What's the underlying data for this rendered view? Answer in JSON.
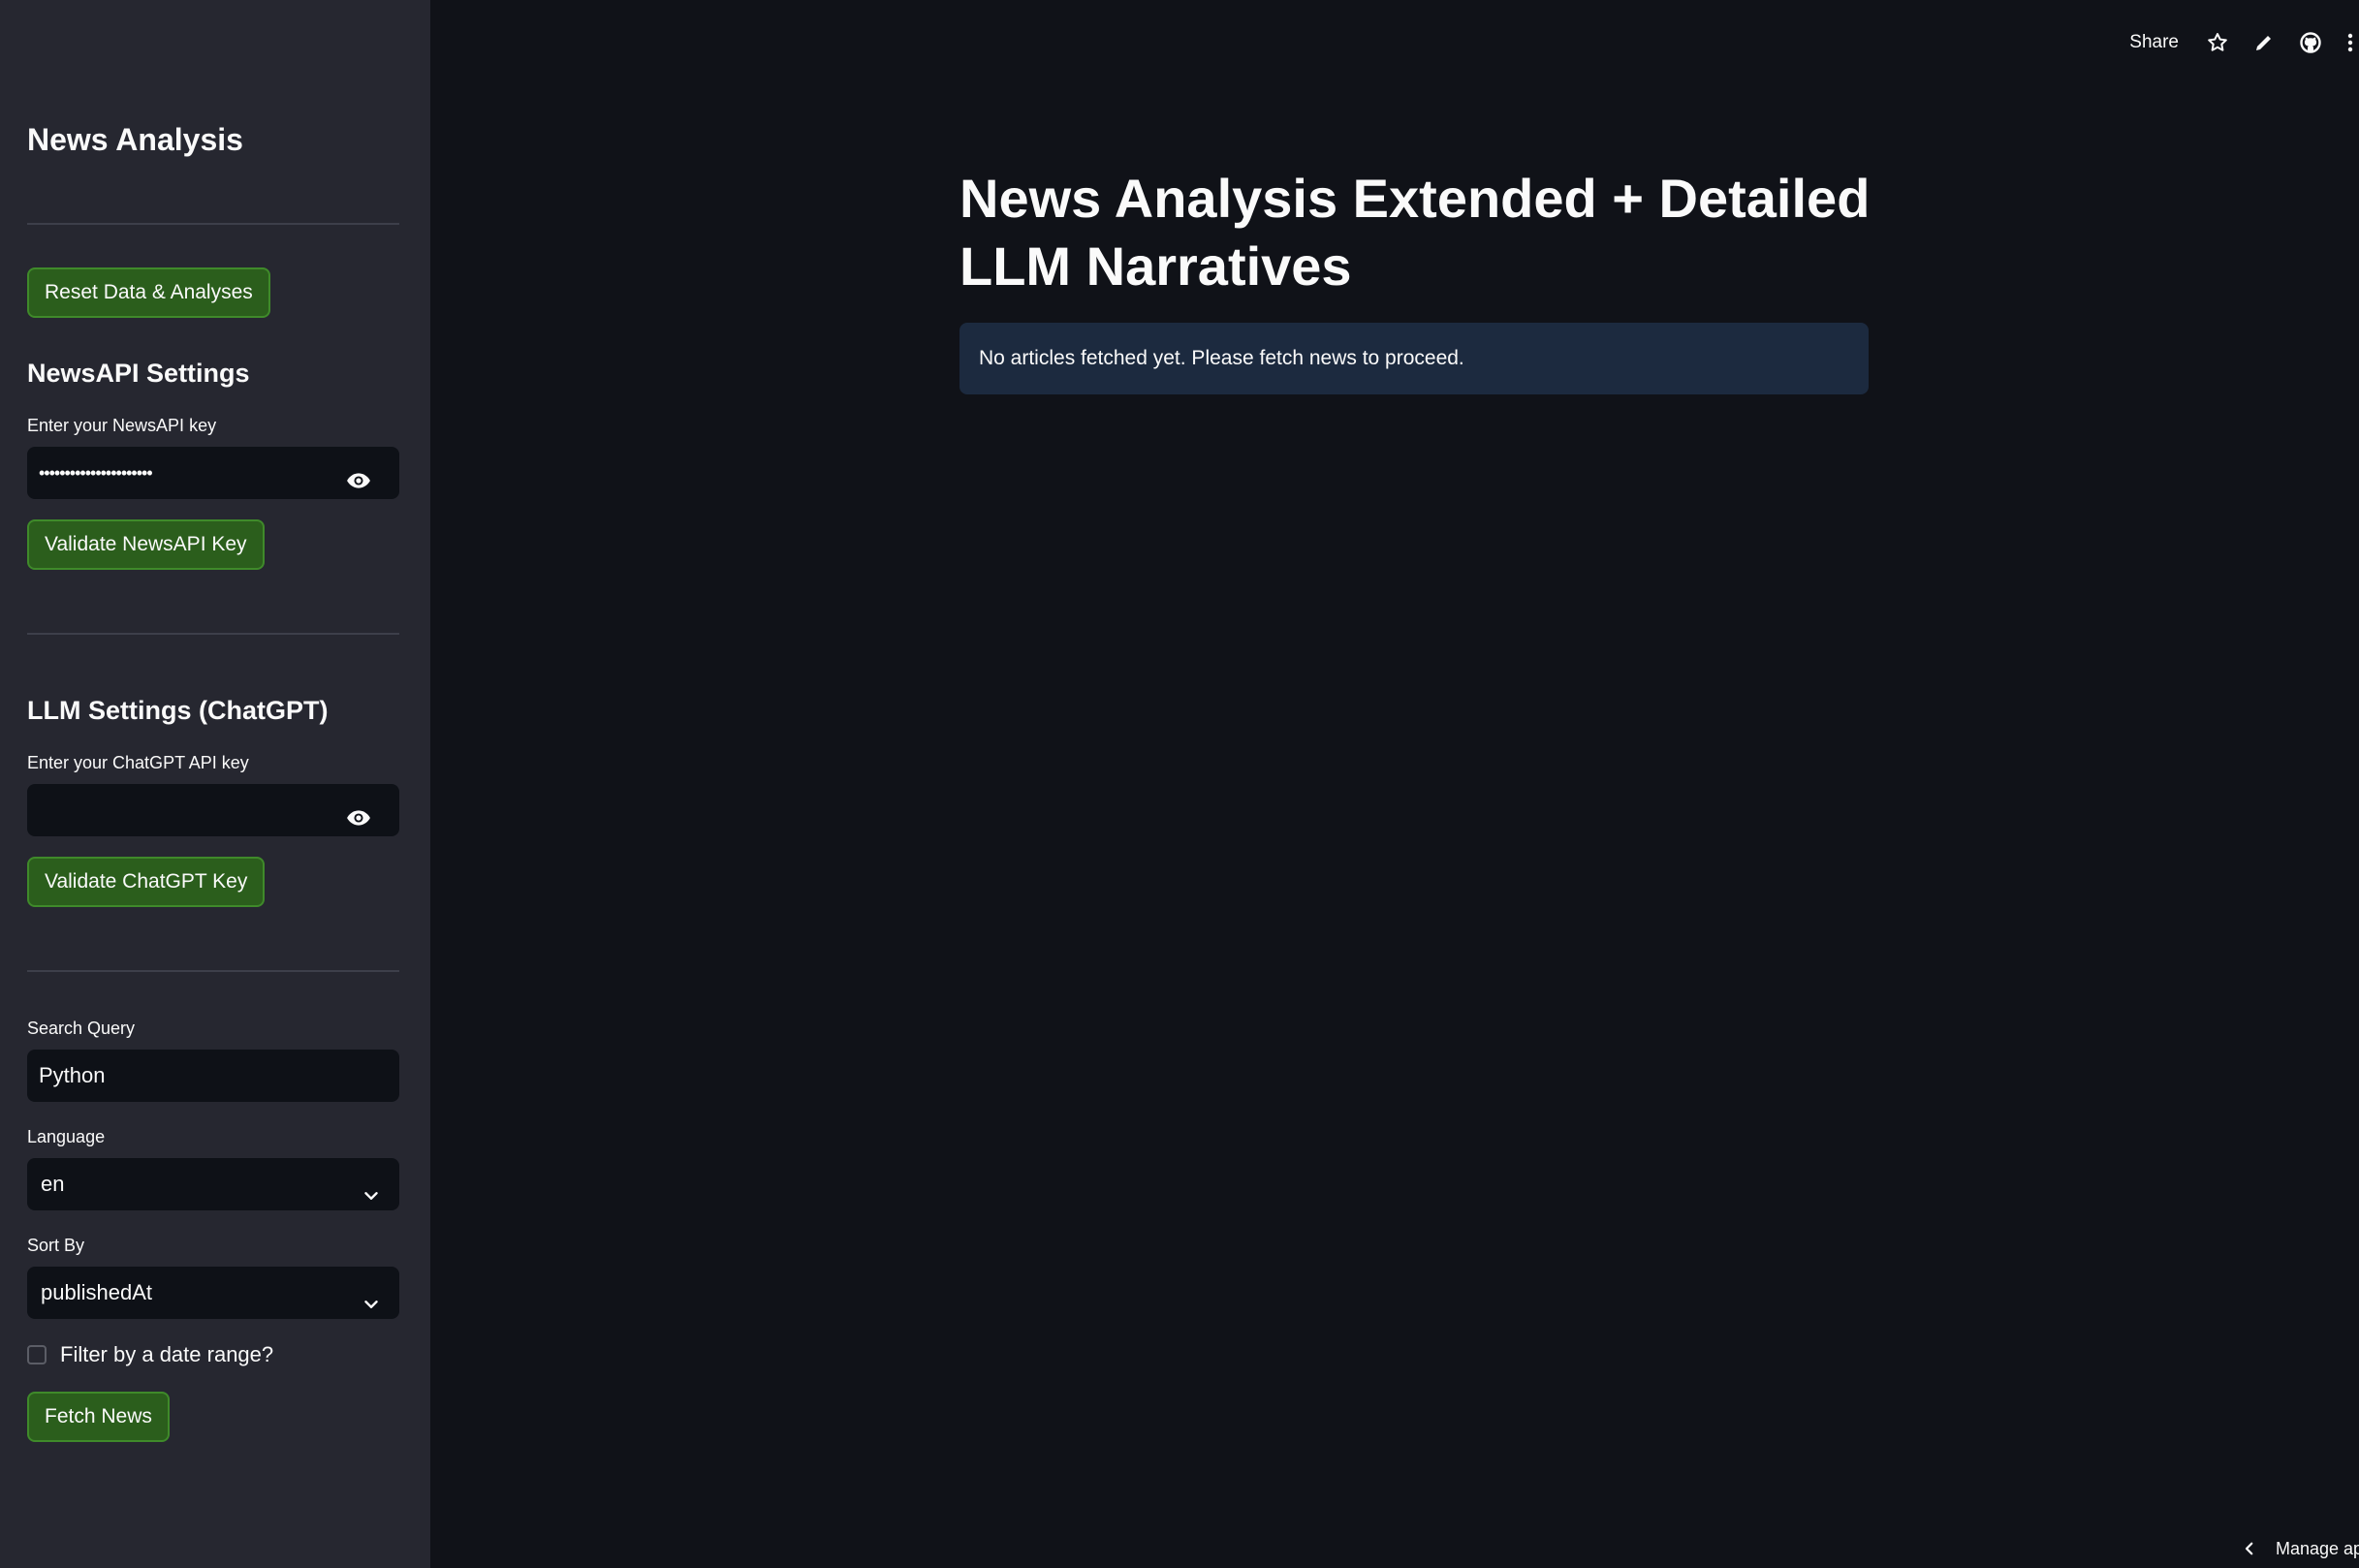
{
  "sidebar": {
    "title": "News Analysis",
    "reset_button": "Reset Data & Analyses",
    "newsapi": {
      "heading": "NewsAPI Settings",
      "key_label": "Enter your NewsAPI key",
      "key_value": "••••••••••••••••••••••",
      "validate_button": "Validate NewsAPI Key"
    },
    "llm": {
      "heading": "LLM Settings (ChatGPT)",
      "key_label": "Enter your ChatGPT API key",
      "key_value": "",
      "validate_button": "Validate ChatGPT Key"
    },
    "search": {
      "label": "Search Query",
      "value": "Python"
    },
    "language": {
      "label": "Language",
      "value": "en"
    },
    "sort_by": {
      "label": "Sort By",
      "value": "publishedAt"
    },
    "date_filter": {
      "label": "Filter by a date range?",
      "checked": false
    },
    "fetch_button": "Fetch News"
  },
  "header": {
    "share_label": "Share",
    "icons": [
      "star-icon",
      "pencil-icon",
      "github-icon",
      "more-vertical-icon"
    ]
  },
  "main": {
    "title": "News Analysis Extended + Detailed LLM Narratives",
    "info_message": "No articles fetched yet. Please fetch news to proceed."
  },
  "footer": {
    "manage_app": "Manage app"
  },
  "colors": {
    "sidebar_bg": "#262730",
    "main_bg": "#101218",
    "button_bg": "#2b5e1c",
    "info_bg": "#1c2a3f"
  }
}
